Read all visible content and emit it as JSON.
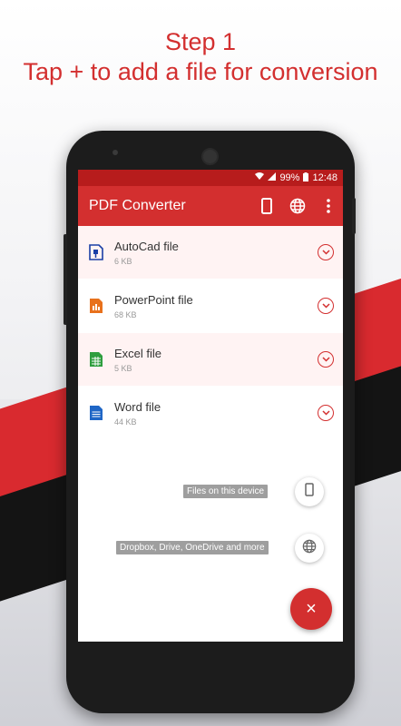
{
  "headline": {
    "line1": "Step 1",
    "line2": "Tap + to add a file for conversion"
  },
  "status_bar": {
    "battery": "99%",
    "time": "12:48"
  },
  "app_bar": {
    "title": "PDF Converter",
    "actions": [
      "phone-icon",
      "globe-icon",
      "more-vert-icon"
    ]
  },
  "files": [
    {
      "name": "AutoCad file",
      "size": "6 KB",
      "icon": "autocad-file-icon",
      "color": "#1a3fa6"
    },
    {
      "name": "PowerPoint file",
      "size": "68 KB",
      "icon": "powerpoint-file-icon",
      "color": "#e8711c"
    },
    {
      "name": "Excel file",
      "size": "5 KB",
      "icon": "excel-file-icon",
      "color": "#2e9e3e"
    },
    {
      "name": "Word file",
      "size": "44 KB",
      "icon": "word-file-icon",
      "color": "#1f66c6"
    }
  ],
  "fab_menu": {
    "device_label": "Files on this device",
    "cloud_label": "Dropbox, Drive, OneDrive and more",
    "close_symbol": "×"
  },
  "colors": {
    "accent": "#d32f2f",
    "status": "#b71c1c"
  }
}
